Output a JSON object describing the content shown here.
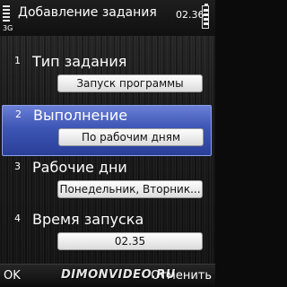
{
  "status_bar": {
    "title": "Добавление задания",
    "time": "02.36",
    "network": "3G",
    "signal_icon": "signal-strength-icon",
    "battery_icon": "battery-icon"
  },
  "items": [
    {
      "number": "1",
      "label": "Тип задания",
      "value": "Запуск программы"
    },
    {
      "number": "2",
      "label": "Выполнение",
      "value": "По рабочим дням"
    },
    {
      "number": "3",
      "label": "Рабочие дни",
      "value": "Понедельник, Вторник..."
    },
    {
      "number": "4",
      "label": "Время запуска",
      "value": "02.35"
    }
  ],
  "selected_index": 1,
  "softkeys": {
    "left": "OK",
    "right": "Отменить"
  },
  "watermark": "DIMONVIDEO.RU",
  "colors": {
    "highlight": "#3d55b4",
    "background": "#1b1b1b",
    "text": "#ffffff"
  }
}
